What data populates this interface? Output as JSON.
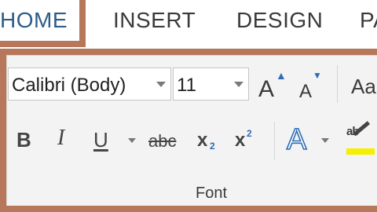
{
  "ribbon": {
    "tabs": [
      {
        "label": "HOME"
      },
      {
        "label": "INSERT"
      },
      {
        "label": "DESIGN"
      },
      {
        "label": "PA"
      }
    ]
  },
  "font_group": {
    "font_name": "Calibri (Body)",
    "font_size": "11",
    "grow_font": "A",
    "grow_arrow": "▲",
    "shrink_font": "A",
    "shrink_arrow": "▼",
    "change_case": "Aa",
    "bold": "B",
    "italic": "I",
    "underline": "U",
    "strikethrough": "abc",
    "subscript_base": "x",
    "subscript_mark": "2",
    "superscript_base": "x",
    "superscript_mark": "2",
    "text_effects": "A",
    "highlight_letters": "ab",
    "label": "Font",
    "accent_color": "#2e6db4",
    "highlight_color": "#f5f000"
  }
}
